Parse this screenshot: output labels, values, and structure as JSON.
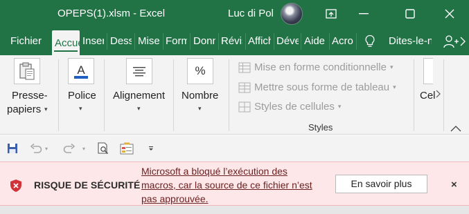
{
  "titlebar": {
    "title": "OPEPS(1).xlsm  -  Excel",
    "user": "Luc di Pol"
  },
  "tabs": [
    {
      "label": "Fichier",
      "active": false
    },
    {
      "label": "Accueil",
      "active": true
    },
    {
      "label": "Insertion",
      "active": false
    },
    {
      "label": "Dessin",
      "active": false
    },
    {
      "label": "Mise en page",
      "active": false
    },
    {
      "label": "Formules",
      "active": false
    },
    {
      "label": "Données",
      "active": false
    },
    {
      "label": "Révision",
      "active": false
    },
    {
      "label": "Affichage",
      "active": false
    },
    {
      "label": "Développeur",
      "active": false
    },
    {
      "label": "Aide",
      "active": false
    },
    {
      "label": "Acrobat",
      "active": false
    }
  ],
  "tell_me": "Dites-le-nous",
  "ribbon": {
    "clipboard": {
      "line1": "Presse-",
      "line2": "papiers"
    },
    "font": {
      "label": "Police"
    },
    "alignment": {
      "label": "Alignement"
    },
    "number": {
      "label": "Nombre",
      "icon_text": "%"
    },
    "styles": {
      "conditional": "Mise en forme conditionnelle",
      "table": "Mettre sous forme de tableau",
      "cell_styles": "Styles de cellules",
      "group_label": "Styles"
    },
    "cells": {
      "label": "Cellules"
    }
  },
  "security_bar": {
    "title": "RISQUE DE SÉCURITÉ",
    "message": "Microsoft a bloqué l’exécution des macros, car la source de ce fichier n’est pas approuvée.",
    "button": "En savoir plus",
    "close": "×"
  },
  "colors": {
    "excel_green": "#217346",
    "security_bg": "#fde7e9",
    "security_icon": "#d13438"
  }
}
